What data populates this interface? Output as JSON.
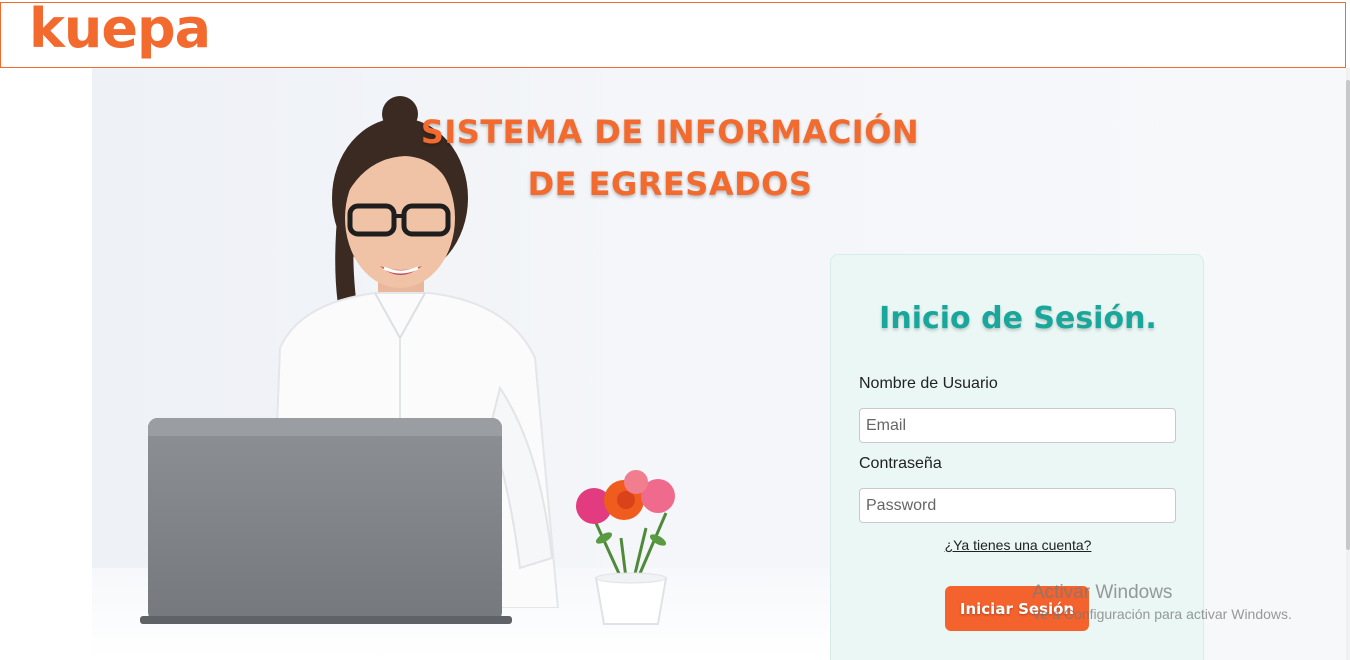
{
  "header": {
    "logo_text": "kuepa"
  },
  "hero": {
    "title_line1": "SISTEMA DE INFORMACIÓN",
    "title_line2": "DE EGRESADOS"
  },
  "login": {
    "title": "Inicio de Sesión.",
    "username_label": "Nombre de Usuario",
    "username_placeholder": "Email",
    "password_label": "Contraseña",
    "password_placeholder": "Password",
    "account_link": "¿Ya tienes una cuenta?",
    "submit_label": "Iniciar Sesión"
  },
  "watermark": {
    "title": "Activar Windows",
    "subtitle": "Ve a Configuración para activar Windows."
  },
  "colors": {
    "brand_orange": "#f26a2e",
    "teal": "#1aa79b",
    "card_bg": "#e8f6f4"
  },
  "icons": {
    "logo": "kuepa-logo",
    "illustration": "woman-with-laptop-illustration",
    "flowers": "flower-pot-illustration"
  }
}
